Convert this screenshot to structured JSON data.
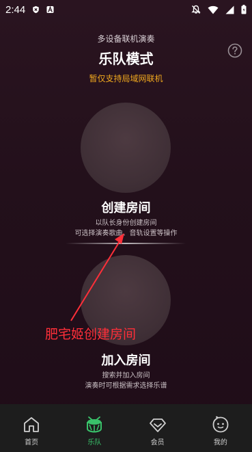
{
  "status": {
    "time": "2:44"
  },
  "header": {
    "subtitle": "多设备联机演奏",
    "title": "乐队模式",
    "notice": "暂仅支持局域网联机"
  },
  "create_room": {
    "title": "创建房间",
    "desc_line1": "以队长身份创建房间",
    "desc_line2": "可选择演奏歌曲、音轨设置等操作"
  },
  "join_room": {
    "title": "加入房间",
    "desc_line1": "搜索并加入房间",
    "desc_line2": "演奏时可根据需求选择乐谱"
  },
  "annotation": {
    "text": "肥宅姬创建房间",
    "color": "#ff2f39"
  },
  "nav": {
    "items": [
      {
        "label": "首页",
        "icon": "home-icon",
        "active": false
      },
      {
        "label": "乐队",
        "icon": "drum-icon",
        "active": true
      },
      {
        "label": "会员",
        "icon": "diamond-icon",
        "active": false
      },
      {
        "label": "我的",
        "icon": "profile-icon",
        "active": false
      }
    ],
    "active_color": "#39c26a"
  },
  "colors": {
    "notice": "#f0a81e",
    "accent": "#39c26a"
  }
}
